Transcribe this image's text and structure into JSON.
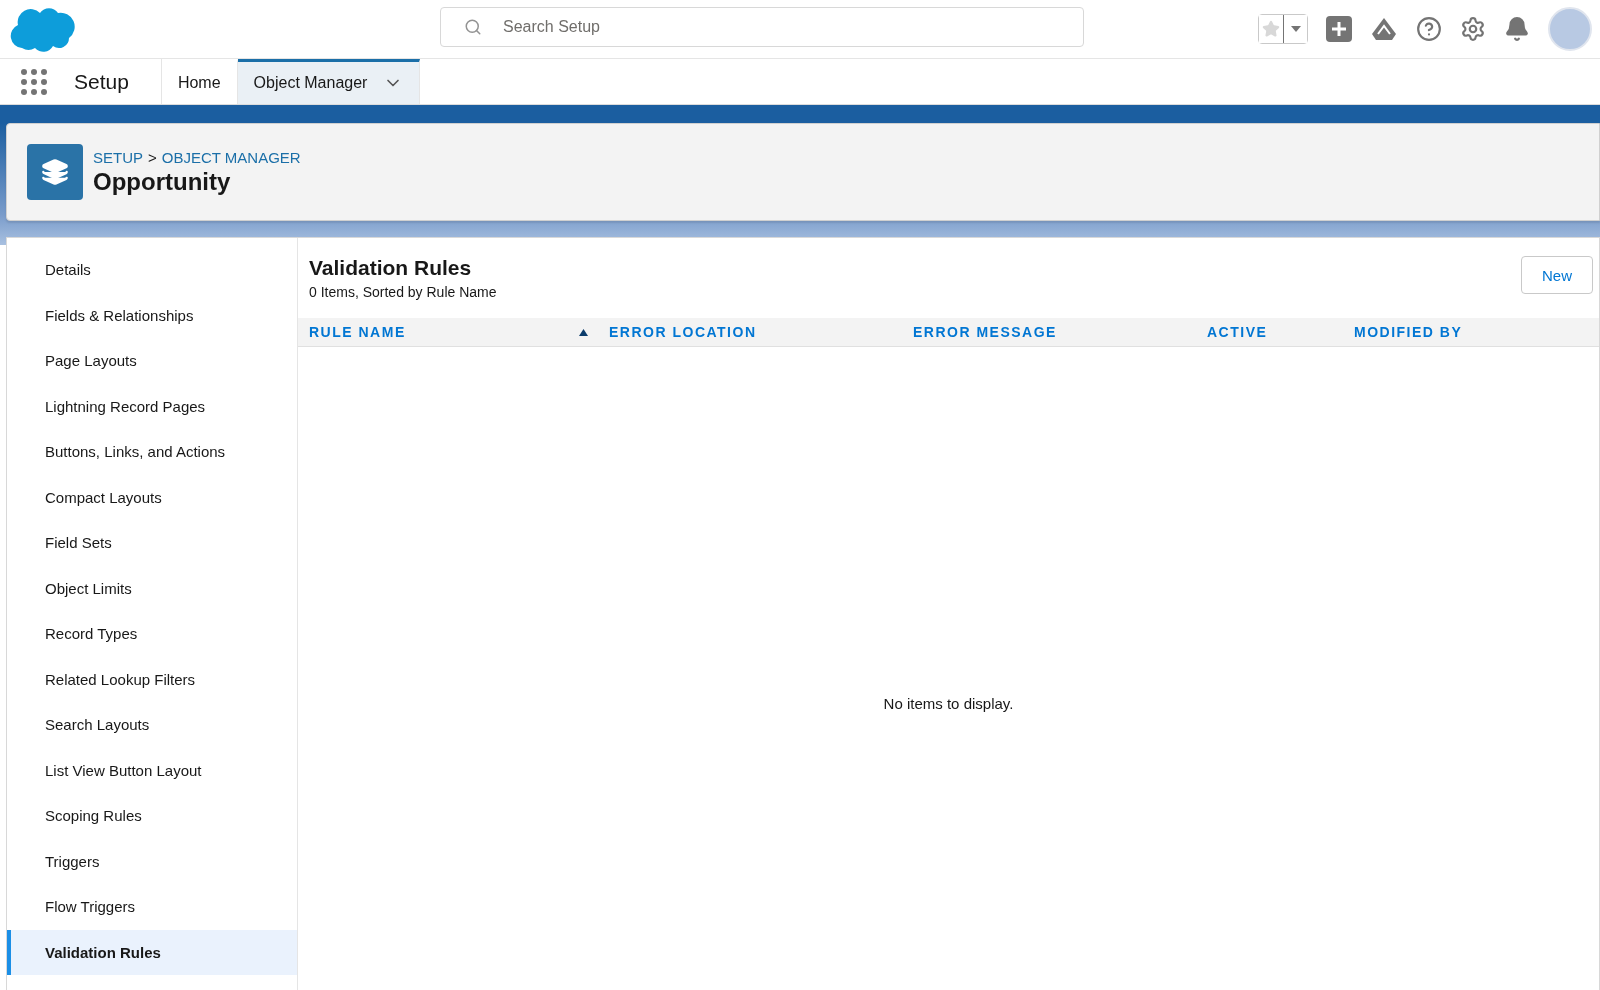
{
  "header": {
    "search": {
      "placeholder": "Search Setup"
    }
  },
  "nav": {
    "app_name": "Setup",
    "tabs": [
      {
        "label": "Home",
        "selected": false,
        "has_menu": false
      },
      {
        "label": "Object Manager",
        "selected": true,
        "has_menu": true
      }
    ]
  },
  "page_header": {
    "breadcrumbs": [
      "SETUP",
      "OBJECT MANAGER"
    ],
    "separator": ">",
    "title": "Opportunity"
  },
  "sidebar": {
    "items": [
      {
        "label": "Details",
        "selected": false
      },
      {
        "label": "Fields & Relationships",
        "selected": false
      },
      {
        "label": "Page Layouts",
        "selected": false
      },
      {
        "label": "Lightning Record Pages",
        "selected": false
      },
      {
        "label": "Buttons, Links, and Actions",
        "selected": false
      },
      {
        "label": "Compact Layouts",
        "selected": false
      },
      {
        "label": "Field Sets",
        "selected": false
      },
      {
        "label": "Object Limits",
        "selected": false
      },
      {
        "label": "Record Types",
        "selected": false
      },
      {
        "label": "Related Lookup Filters",
        "selected": false
      },
      {
        "label": "Search Layouts",
        "selected": false
      },
      {
        "label": "List View Button Layout",
        "selected": false
      },
      {
        "label": "Scoping Rules",
        "selected": false
      },
      {
        "label": "Triggers",
        "selected": false
      },
      {
        "label": "Flow Triggers",
        "selected": false
      },
      {
        "label": "Validation Rules",
        "selected": true
      }
    ]
  },
  "main": {
    "title": "Validation Rules",
    "subtitle": "0 Items, Sorted by Rule Name",
    "new_button": "New",
    "table": {
      "columns": [
        {
          "label": "RULE NAME",
          "sorted": true
        },
        {
          "label": "ERROR LOCATION",
          "sorted": false
        },
        {
          "label": "ERROR MESSAGE",
          "sorted": false
        },
        {
          "label": "ACTIVE",
          "sorted": false
        },
        {
          "label": "MODIFIED BY",
          "sorted": false
        }
      ],
      "empty_message": "No items to display."
    }
  }
}
